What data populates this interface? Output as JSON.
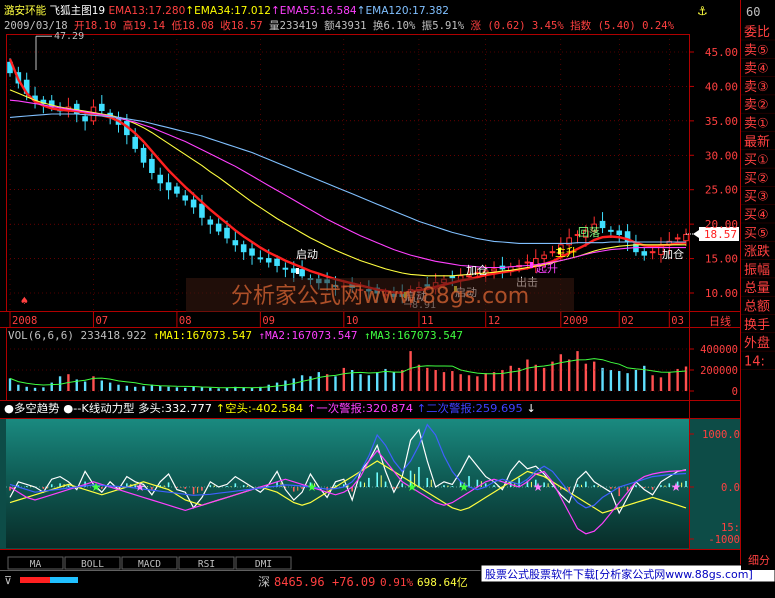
{
  "header": {
    "stock_name": "潞安环能",
    "indicator_name": "飞狐主图19",
    "ema_items": [
      {
        "label": "EMA13:17.280",
        "color": "#ff4040"
      },
      {
        "label": "EMA34:17.012",
        "color": "#ffff00"
      },
      {
        "label": "EMA55:16.584",
        "color": "#ff40ff"
      },
      {
        "label": "EMA120:17.382",
        "color": "#80c0ff"
      }
    ],
    "info_line": [
      {
        "text": "2009/03/18",
        "color": "#c0c0c0"
      },
      {
        "text": "开18.10",
        "color": "#ff4040"
      },
      {
        "text": "高19.14",
        "color": "#ff4040"
      },
      {
        "text": "低18.08",
        "color": "#ff4040"
      },
      {
        "text": "收18.57",
        "color": "#ff4040"
      },
      {
        "text": "量233419",
        "color": "#c0c0c0"
      },
      {
        "text": "额43931",
        "color": "#c0c0c0"
      },
      {
        "text": "换6.10%",
        "color": "#c0c0c0"
      },
      {
        "text": "振5.91%",
        "color": "#c0c0c0"
      },
      {
        "text": "涨 (0.62) 3.45%",
        "color": "#ff4040"
      },
      {
        "text": "指数 (5.40) 0.24%",
        "color": "#ff4040"
      }
    ]
  },
  "watermark": "分析家公式网www.88gs.com",
  "right_panel": {
    "top_number": "60",
    "items": [
      "委比",
      "卖⑤",
      "卖④",
      "卖③",
      "卖②",
      "卖①",
      "最新",
      "买①",
      "买②",
      "买③",
      "买④",
      "买⑤",
      "涨跌",
      "振幅",
      "总量",
      "总额",
      "换手",
      "外盘",
      "14:"
    ],
    "bottom_label": "细分"
  },
  "price_panel": {
    "y_labels": [
      "45.00",
      "40.00",
      "35.00",
      "30.00",
      "25.00",
      "20.00",
      "15.00",
      "10.00"
    ],
    "x_labels": [
      "2008",
      "07",
      "08",
      "09",
      "10",
      "11",
      "12",
      "2009",
      "02",
      "03"
    ],
    "period_label": "日线",
    "current_price": "18.57",
    "high_label": "47.29",
    "low_label": "8.91",
    "annotations": [
      {
        "text": "启动",
        "color": "#ffffff"
      },
      {
        "text": "启动",
        "color": "#ffffff"
      },
      {
        "text": "启动",
        "color": "#ffffff"
      },
      {
        "text": "加仓",
        "color": "#ffffff"
      },
      {
        "text": "出击",
        "color": "#ffffff"
      },
      {
        "text": "起升",
        "color": "#ff40ff"
      },
      {
        "text": "主升",
        "color": "#ffff00"
      },
      {
        "text": "回落",
        "color": "#80ff80"
      },
      {
        "text": "加仓",
        "color": "#ffffff"
      }
    ]
  },
  "volume_panel": {
    "header": [
      {
        "text": "VOL(6,6,6)",
        "color": "#c0c0c0"
      },
      {
        "text": "233418.922",
        "color": "#c0c0c0"
      },
      {
        "text": "↑MA1:167073.547",
        "color": "#ffff00"
      },
      {
        "text": "↑MA2:167073.547",
        "color": "#ff40ff"
      },
      {
        "text": "↑MA3:167073.547",
        "color": "#40ff40"
      }
    ],
    "y_labels": [
      "400000",
      "200000",
      "0"
    ]
  },
  "osc_panel": {
    "header": [
      {
        "text": "●多空趋势",
        "color": "#ffffff"
      },
      {
        "text": "●--K线动力型",
        "color": "#ffffff"
      },
      {
        "text": "多头:332.777",
        "color": "#ffffff"
      },
      {
        "text": "↑空头:-402.584",
        "color": "#ffff00"
      },
      {
        "text": "↑一次警报:320.874",
        "color": "#ff40ff"
      },
      {
        "text": "↑二次警报:259.695",
        "color": "#4040ff"
      },
      {
        "text": "↓",
        "color": "#ffffff"
      }
    ],
    "y_labels": [
      "1000.0",
      "0.0",
      "15:",
      "-1000"
    ]
  },
  "bottom_tabs": [
    "MA",
    "BOLL",
    "MACD",
    "RSI",
    "DMI"
  ],
  "status_bar": {
    "market": "深",
    "index_value": "8465.96",
    "index_change": "+76.09",
    "index_pct": "0.91%",
    "index_amount": "698.64亿",
    "ad_text": "股票公式股票软件下载[分析家公式网www.88gs.com]"
  },
  "chart_data": [
    {
      "type": "candlestick",
      "title": "潞安环能",
      "x_ticks": [
        "2008",
        "07",
        "08",
        "09",
        "10",
        "11",
        "12",
        "2009",
        "02",
        "03"
      ],
      "ylim": [
        8,
        48
      ],
      "y_ticks": [
        45,
        40,
        35,
        30,
        25,
        20,
        15,
        10
      ],
      "high_marker": 47.29,
      "low_marker": 8.91,
      "last_close": 18.57,
      "close_path": [
        42,
        40.5,
        39,
        38,
        37.5,
        37,
        36.5,
        37,
        36,
        35,
        37,
        36.5,
        35.5,
        34.5,
        33,
        31,
        29,
        27.5,
        26,
        25,
        24.5,
        23.5,
        22.5,
        21,
        20,
        19,
        18,
        17,
        16,
        15.5,
        15,
        14.5,
        14,
        13.5,
        13,
        12.5,
        12,
        11.5,
        11.5,
        11,
        11,
        10.8,
        10.5,
        10.3,
        10,
        9.8,
        9.5,
        9.5,
        10.5,
        10.8,
        11,
        11.5,
        12,
        12.2,
        12.5,
        12.5,
        13,
        13.2,
        13.5,
        13.5,
        13.8,
        14,
        14.5,
        15,
        15.5,
        16,
        17,
        18,
        18.5,
        19,
        20,
        19.5,
        19,
        18.5,
        17.5,
        16,
        15.5,
        16,
        17,
        17.5,
        18,
        18.5
      ],
      "series": [
        {
          "name": "EMA13",
          "color": "#ff2020",
          "values": [
            44,
            41,
            39,
            37.8,
            37.2,
            36.8,
            36.6,
            36.5,
            36.4,
            36.2,
            36,
            35.8,
            35.5,
            35,
            34.2,
            33.2,
            32,
            30.6,
            29.2,
            27.8,
            26.6,
            25.4,
            24.3,
            23.2,
            22.1,
            21.1,
            20.1,
            19.1,
            18.2,
            17.4,
            16.6,
            15.9,
            15.3,
            14.7,
            14.2,
            13.7,
            13.2,
            12.8,
            12.4,
            12,
            11.7,
            11.4,
            11.1,
            10.8,
            10.5,
            10.3,
            10.1,
            10,
            10.2,
            10.4,
            10.6,
            10.9,
            11.2,
            11.5,
            11.8,
            12,
            12.3,
            12.6,
            12.8,
            13,
            13.2,
            13.4,
            13.6,
            13.9,
            14.2,
            14.6,
            15.2,
            15.8,
            16.4,
            17,
            17.7,
            18.1,
            18.2,
            18.1,
            17.8,
            17.3,
            16.9,
            16.8,
            16.9,
            17,
            17.2,
            17.3
          ]
        },
        {
          "name": "EMA34",
          "color": "#ffff40",
          "values": [
            39.5,
            39,
            38.5,
            38,
            37.6,
            37.3,
            37,
            36.8,
            36.6,
            36.4,
            36.2,
            36,
            35.8,
            35.5,
            35.1,
            34.6,
            34,
            33.3,
            32.5,
            31.7,
            30.9,
            30.1,
            29.3,
            28.5,
            27.6,
            26.8,
            25.9,
            25,
            24.1,
            23.2,
            22.4,
            21.6,
            20.8,
            20.1,
            19.4,
            18.7,
            18,
            17.4,
            16.8,
            16.2,
            15.7,
            15.2,
            14.7,
            14.3,
            13.9,
            13.5,
            13.2,
            12.9,
            12.7,
            12.6,
            12.5,
            12.5,
            12.5,
            12.5,
            12.6,
            12.7,
            12.8,
            12.9,
            13,
            13.2,
            13.3,
            13.5,
            13.7,
            13.9,
            14.1,
            14.4,
            14.7,
            15,
            15.3,
            15.7,
            16.1,
            16.4,
            16.6,
            16.8,
            16.9,
            17,
            17,
            17,
            17,
            17,
            17,
            17
          ]
        },
        {
          "name": "EMA55",
          "color": "#ff40ff",
          "values": [
            38,
            37.9,
            37.7,
            37.5,
            37.3,
            37.1,
            36.9,
            36.7,
            36.5,
            36.3,
            36.1,
            35.9,
            35.7,
            35.4,
            35.1,
            34.8,
            34.4,
            34,
            33.5,
            33,
            32.5,
            32,
            31.4,
            30.8,
            30.2,
            29.6,
            29,
            28.4,
            27.7,
            27,
            26.3,
            25.6,
            24.9,
            24.2,
            23.5,
            22.8,
            22.1,
            21.4,
            20.7,
            20.1,
            19.5,
            18.9,
            18.3,
            17.8,
            17.3,
            16.8,
            16.3,
            15.9,
            15.5,
            15.2,
            14.9,
            14.6,
            14.4,
            14.2,
            14,
            13.9,
            13.8,
            13.7,
            13.7,
            13.7,
            13.8,
            13.9,
            14,
            14.1,
            14.3,
            14.5,
            14.7,
            15,
            15.3,
            15.6,
            15.9,
            16.1,
            16.3,
            16.4,
            16.5,
            16.6,
            16.6,
            16.6,
            16.6,
            16.6,
            16.6,
            16.6
          ]
        },
        {
          "name": "EMA120",
          "color": "#80c0ff",
          "values": [
            35.5,
            35.6,
            35.7,
            35.8,
            35.9,
            36,
            36,
            36,
            36,
            35.9,
            35.8,
            35.7,
            35.6,
            35.5,
            35.3,
            35.1,
            34.9,
            34.6,
            34.3,
            34,
            33.7,
            33.4,
            33.1,
            32.8,
            32.4,
            32,
            31.6,
            31.2,
            30.8,
            30.4,
            29.9,
            29.4,
            28.9,
            28.4,
            27.9,
            27.4,
            26.9,
            26.4,
            25.9,
            25.4,
            24.9,
            24.4,
            23.9,
            23.4,
            22.9,
            22.4,
            21.9,
            21.4,
            20.9,
            20.4,
            20,
            19.6,
            19.2,
            18.8,
            18.5,
            18.2,
            17.9,
            17.7,
            17.5,
            17.4,
            17.3,
            17.2,
            17.2,
            17.2,
            17.2,
            17.2,
            17.2,
            17.2,
            17.3,
            17.3,
            17.3,
            17.3,
            17.4,
            17.4,
            17.4,
            17.4,
            17.4,
            17.4,
            17.4,
            17.4,
            17.4,
            17.4
          ]
        }
      ]
    },
    {
      "type": "bar",
      "title": "VOL(6,6,6)",
      "ylim": [
        0,
        480000
      ],
      "y_ticks": [
        400000,
        200000,
        0
      ],
      "values": [
        120000,
        60000,
        40000,
        30000,
        35000,
        80000,
        140000,
        160000,
        110000,
        90000,
        140000,
        100000,
        80000,
        60000,
        50000,
        40000,
        45000,
        60000,
        50000,
        40000,
        35000,
        30000,
        40000,
        35000,
        30000,
        25000,
        30000,
        40000,
        35000,
        30000,
        40000,
        60000,
        80000,
        100000,
        120000,
        150000,
        140000,
        180000,
        160000,
        140000,
        220000,
        200000,
        160000,
        150000,
        180000,
        210000,
        180000,
        200000,
        380000,
        250000,
        220000,
        200000,
        180000,
        190000,
        160000,
        150000,
        140000,
        170000,
        180000,
        200000,
        240000,
        220000,
        300000,
        250000,
        220000,
        280000,
        350000,
        300000,
        380000,
        260000,
        280000,
        220000,
        200000,
        190000,
        170000,
        200000,
        240000,
        150000,
        130000,
        180000,
        210000,
        233419
      ]
    },
    {
      "type": "line",
      "title": "多空趋势 K线动力型",
      "ylim": [
        -1300,
        1300
      ],
      "y_ticks": [
        1000,
        0,
        -1000
      ],
      "series": [
        {
          "name": "多头",
          "color": "#ffffff",
          "values": [
            -200,
            100,
            50,
            0,
            -100,
            150,
            200,
            100,
            -50,
            300,
            50,
            -100,
            100,
            -50,
            200,
            100,
            50,
            -150,
            100,
            250,
            -50,
            -100,
            -400,
            -200,
            100,
            0,
            50,
            200,
            100,
            0,
            -100,
            50,
            300,
            -50,
            -250,
            -100,
            250,
            0,
            -200,
            100,
            150,
            -250,
            300,
            500,
            800,
            300,
            -100,
            200,
            900,
            1100,
            500,
            0,
            100,
            50,
            300,
            600,
            400,
            200,
            100,
            -50,
            300,
            500,
            350,
            400,
            250,
            50,
            -150,
            -300,
            150,
            300,
            100,
            0,
            -100,
            -500,
            -200,
            100,
            -50,
            -150,
            100,
            200,
            300,
            332
          ]
        },
        {
          "name": "空头",
          "color": "#ffff40",
          "values": [
            -300,
            -250,
            -200,
            -150,
            -100,
            -50,
            0,
            50,
            0,
            -50,
            -100,
            -150,
            -100,
            -50,
            0,
            50,
            100,
            50,
            0,
            -50,
            -150,
            -250,
            -300,
            -350,
            -300,
            -250,
            -200,
            -150,
            -100,
            -50,
            0,
            -50,
            -100,
            -200,
            -300,
            -350,
            -300,
            -200,
            -100,
            0,
            100,
            200,
            300,
            400,
            500,
            400,
            300,
            200,
            100,
            0,
            -100,
            -200,
            -300,
            -400,
            -450,
            -400,
            -300,
            -200,
            -100,
            0,
            100,
            200,
            300,
            250,
            200,
            100,
            0,
            -100,
            -200,
            -300,
            -400,
            -500,
            -450,
            -400,
            -350,
            -300,
            -250,
            -200,
            -250,
            -300,
            -350,
            -402
          ]
        },
        {
          "name": "一次警报",
          "color": "#ff40ff",
          "values": [
            0,
            -100,
            -200,
            -250,
            -200,
            -150,
            -100,
            -50,
            0,
            50,
            100,
            50,
            0,
            -50,
            -100,
            -150,
            -200,
            -250,
            -300,
            -350,
            -400,
            -450,
            -400,
            -350,
            -300,
            -250,
            -200,
            -150,
            -100,
            -50,
            0,
            50,
            100,
            150,
            100,
            50,
            0,
            -50,
            -100,
            -150,
            -100,
            0,
            200,
            500,
            700,
            500,
            300,
            100,
            0,
            -100,
            -200,
            -300,
            -350,
            -300,
            -200,
            -100,
            0,
            100,
            150,
            100,
            50,
            0,
            100,
            250,
            300,
            100,
            -200,
            -500,
            -800,
            -900,
            -850,
            -700,
            -500,
            -300,
            -100,
            100,
            200,
            250,
            280,
            300,
            310,
            320
          ]
        },
        {
          "name": "二次警报",
          "color": "#4060ff",
          "values": [
            50,
            0,
            -50,
            -100,
            -80,
            -60,
            -40,
            -20,
            0,
            20,
            40,
            30,
            20,
            10,
            0,
            -20,
            -40,
            -60,
            -80,
            -100,
            -120,
            -140,
            -160,
            -150,
            -140,
            -120,
            -100,
            -80,
            -60,
            -40,
            -20,
            0,
            20,
            40,
            30,
            20,
            0,
            -20,
            -40,
            -30,
            0,
            100,
            300,
            600,
            1000,
            800,
            500,
            300,
            500,
            800,
            1200,
            1000,
            600,
            300,
            100,
            0,
            -50,
            0,
            100,
            150,
            100,
            50,
            150,
            300,
            400,
            300,
            100,
            -100,
            -300,
            -400,
            -350,
            -200,
            -100,
            0,
            50,
            100,
            150,
            200,
            220,
            240,
            250,
            260
          ]
        }
      ]
    }
  ]
}
